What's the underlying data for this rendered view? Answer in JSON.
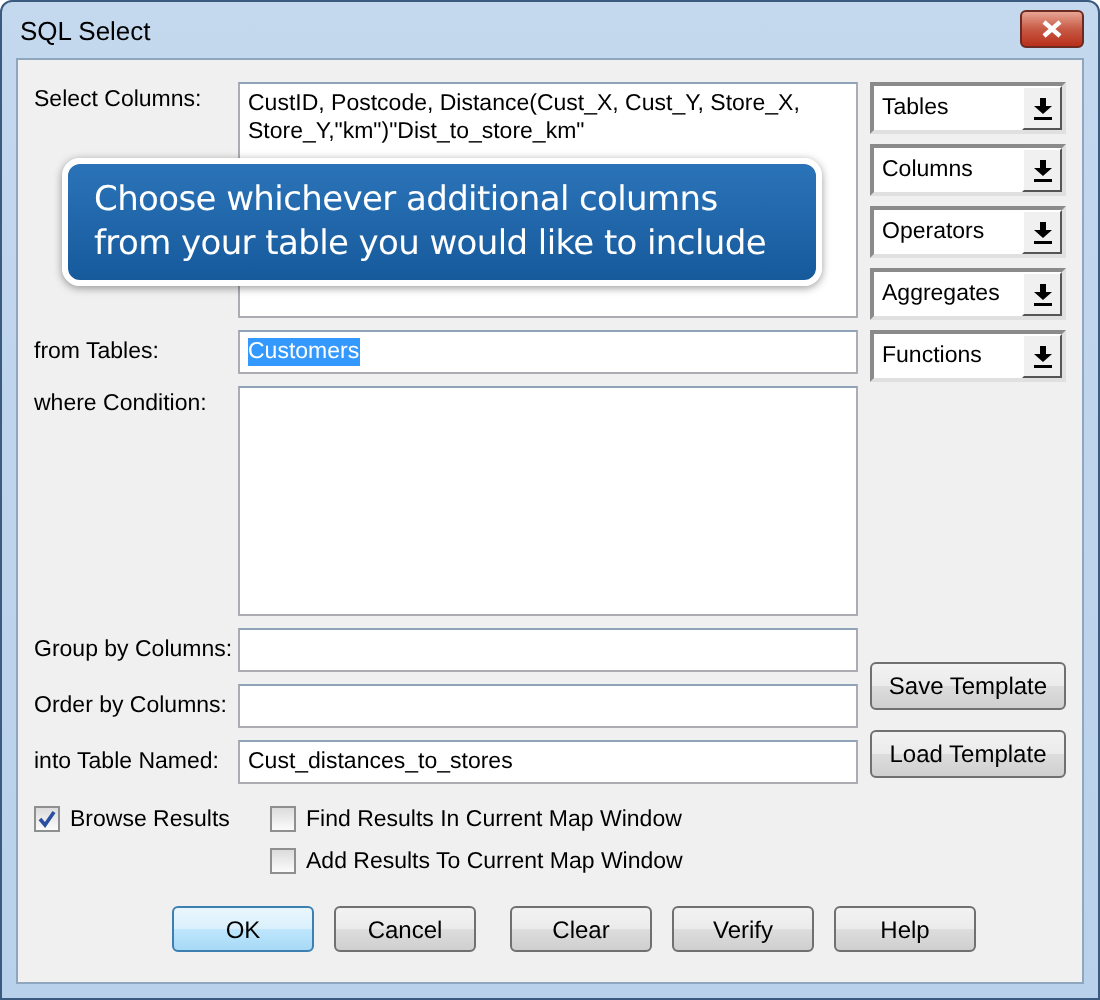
{
  "window": {
    "title": "SQL Select"
  },
  "fields": [
    {
      "label": "Select Columns:",
      "kind": "multiline",
      "value": "CustID, Postcode, Distance(Cust_X, Cust_Y, Store_X, Store_Y,\"km\")\"Dist_to_store_km\"",
      "highlighted": false
    },
    {
      "label": "from Tables:",
      "kind": "line",
      "value": "Customers",
      "highlighted": true
    },
    {
      "label": "where Condition:",
      "kind": "multiline"
    },
    {
      "label": "Group by Columns:",
      "kind": "line"
    },
    {
      "label": "Order by Columns:",
      "kind": "line"
    },
    {
      "label": "into Table Named:",
      "kind": "line",
      "value": "Cust_distances_to_stores",
      "highlighted": false
    }
  ],
  "pickers": [
    "Tables",
    "Columns",
    "Operators",
    "Aggregates",
    "Functions"
  ],
  "template_buttons": [
    "Save Template",
    "Load Template"
  ],
  "checkboxes": [
    {
      "label": "Browse Results",
      "checked": true
    },
    {
      "label": "Find Results In Current Map Window",
      "checked": false
    },
    {
      "label": "Add Results To Current Map Window",
      "checked": false
    }
  ],
  "buttons": [
    {
      "label": "OK",
      "default": true
    },
    {
      "label": "Cancel",
      "default": false
    },
    {
      "label": "Clear",
      "default": false
    },
    {
      "label": "Verify",
      "default": false
    },
    {
      "label": "Help",
      "default": false
    }
  ],
  "callout": "Choose whichever additional columns from your table you would like to include"
}
